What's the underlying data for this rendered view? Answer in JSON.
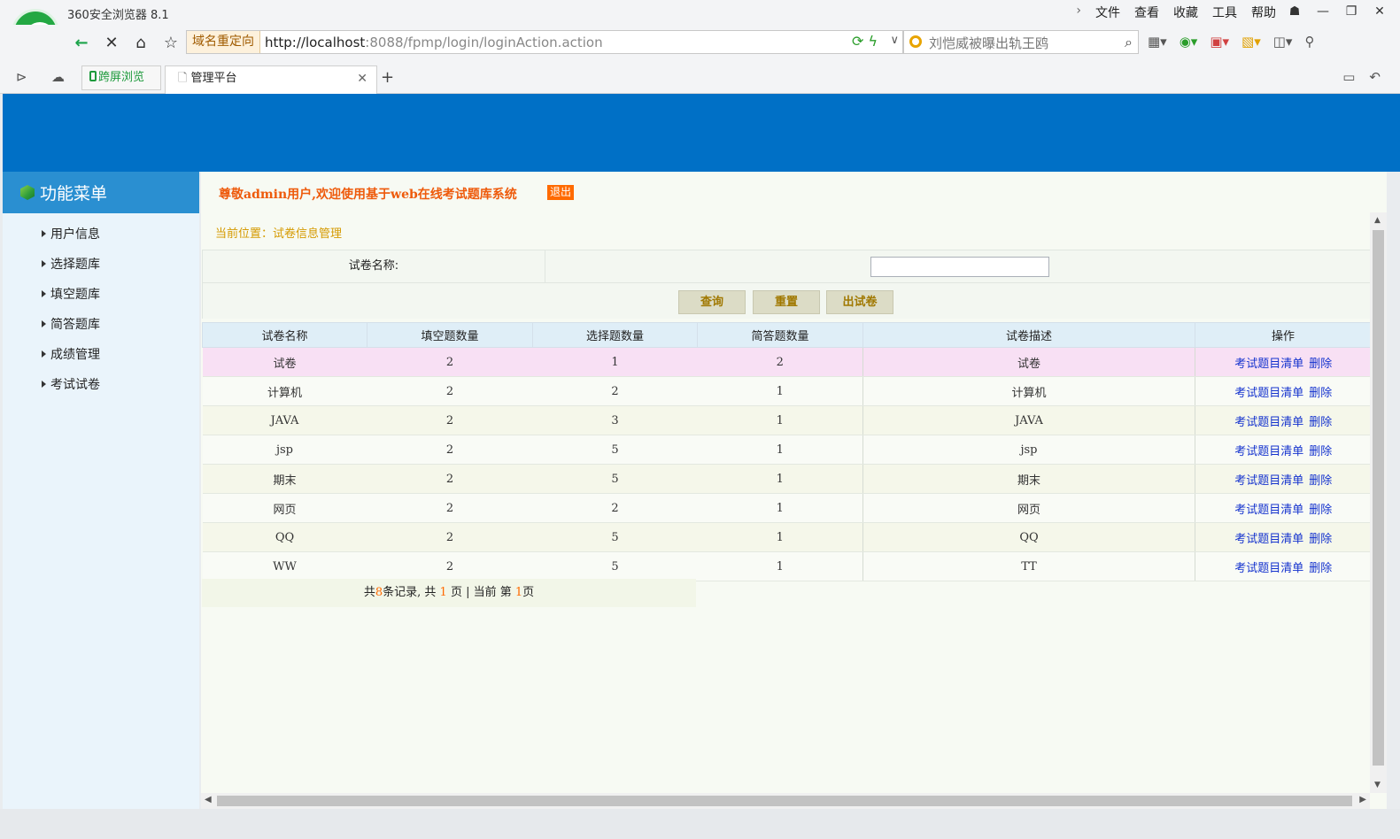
{
  "browser": {
    "app_title": "360安全浏览器 8.1",
    "menu": [
      "文件",
      "查看",
      "收藏",
      "工具",
      "帮助"
    ],
    "redirect_badge": "域名重定向",
    "url_host": "http://localhost",
    "url_path": ":8088/fpmp/login/loginAction.action",
    "search_text": "刘恺威被曝出轨王鸥",
    "tabs": {
      "cross_screen": "跨屏浏览",
      "active": "管理平台"
    }
  },
  "sidebar": {
    "title": "功能菜单",
    "items": [
      "用户信息",
      "选择题库",
      "填空题库",
      "简答题库",
      "成绩管理",
      "考试试卷"
    ]
  },
  "header": {
    "welcome": "尊敬admin用户,欢迎使用基于web在线考试题库系统",
    "logout": "退出",
    "breadcrumb": "当前位置：试卷信息管理"
  },
  "search": {
    "label": "试卷名称:",
    "value": "",
    "buttons": {
      "query": "查询",
      "reset": "重置",
      "make": "出试卷"
    }
  },
  "table": {
    "headers": [
      "试卷名称",
      "填空题数量",
      "选择题数量",
      "简答题数量",
      "试卷描述",
      "操作"
    ],
    "rows": [
      {
        "name": "试卷",
        "fill": "2",
        "choice": "1",
        "short": "2",
        "desc": "试卷"
      },
      {
        "name": "计算机",
        "fill": "2",
        "choice": "2",
        "short": "1",
        "desc": "计算机"
      },
      {
        "name": "JAVA",
        "fill": "2",
        "choice": "3",
        "short": "1",
        "desc": "JAVA"
      },
      {
        "name": "jsp",
        "fill": "2",
        "choice": "5",
        "short": "1",
        "desc": "jsp"
      },
      {
        "name": "期末",
        "fill": "2",
        "choice": "5",
        "short": "1",
        "desc": "期末"
      },
      {
        "name": "网页",
        "fill": "2",
        "choice": "2",
        "short": "1",
        "desc": "网页"
      },
      {
        "name": "QQ",
        "fill": "2",
        "choice": "5",
        "short": "1",
        "desc": "QQ"
      },
      {
        "name": "WW",
        "fill": "2",
        "choice": "5",
        "short": "1",
        "desc": "TT"
      }
    ],
    "action_list": "考试题目清单",
    "action_delete": "删除"
  },
  "pager": {
    "prefix": "共",
    "total": "8",
    "records_suffix": "条记录,",
    "pages_prefix": " 共 ",
    "pages": "1",
    "pages_suffix": " 页 | 当前 第 ",
    "current": "1",
    "current_suffix": "页"
  },
  "colors": {
    "banner": "#0070c6",
    "sidebar_header": "#2a8fd1",
    "welcome": "#ee5a0b",
    "link": "#1533ce",
    "highlight_row": "#f8e0f4"
  }
}
